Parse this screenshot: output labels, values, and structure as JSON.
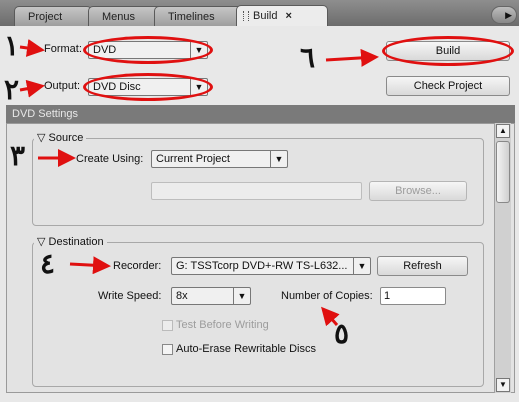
{
  "tabs": [
    {
      "label": "Project"
    },
    {
      "label": "Menus"
    },
    {
      "label": "Timelines"
    },
    {
      "label": "Build",
      "close": "×"
    }
  ],
  "panel_menu_glyph": "▶",
  "format": {
    "label": "Format:",
    "value": "DVD"
  },
  "output": {
    "label": "Output:",
    "value": "DVD Disc"
  },
  "buttons": {
    "build": "Build",
    "check_project": "Check Project",
    "browse": "Browse...",
    "refresh": "Refresh"
  },
  "settings_title": "DVD Settings",
  "source": {
    "title": "Source",
    "create_using_label": "Create Using:",
    "create_using_value": "Current Project",
    "path_value": ""
  },
  "destination": {
    "title": "Destination",
    "recorder_label": "Recorder:",
    "recorder_value": "G: TSSTcorp DVD+-RW TS-L632...",
    "write_speed_label": "Write Speed:",
    "write_speed_value": "8x",
    "copies_label": "Number of Copies:",
    "copies_value": "1",
    "test_before_writing": "Test Before Writing",
    "auto_erase": "Auto-Erase Rewritable Discs"
  },
  "annotations": {
    "n1": "١",
    "n2": "٢",
    "n3": "٣",
    "n4": "٤",
    "n5": "٥",
    "n6": "٦"
  },
  "icons": {
    "dropdown": "▼",
    "collapse": "▽",
    "scroll_up": "▲",
    "scroll_down": "▼"
  },
  "colors": {
    "annotation": "#e01010"
  }
}
